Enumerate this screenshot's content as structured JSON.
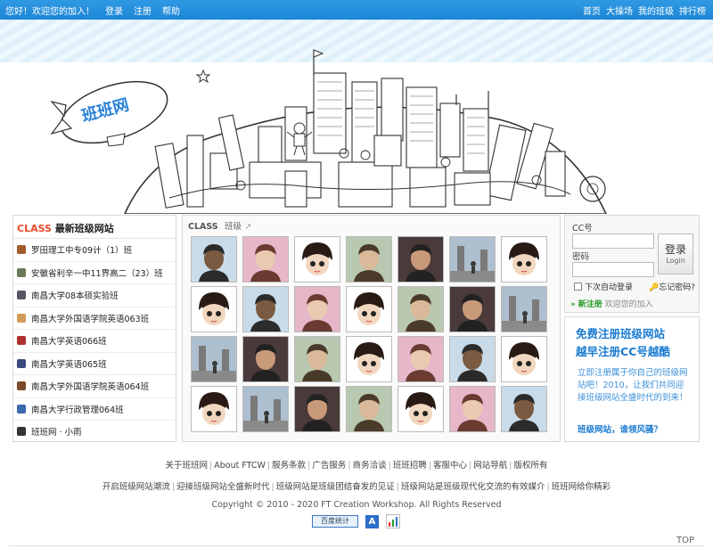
{
  "topbar": {
    "greeting": "您好！欢迎您的加入！",
    "login": "登录",
    "register": "注册",
    "help": "帮助",
    "nav": [
      "首页",
      "大操场",
      "我的班级",
      "排行榜"
    ]
  },
  "banner": {
    "logo_text": "班班网"
  },
  "newclasses": {
    "title_accent": "CLASS",
    "title": "最新班级网站",
    "items": [
      {
        "label": "罗田理工中专09计（1）班"
      },
      {
        "label": "安徽省利辛一中11界高二（23）班"
      },
      {
        "label": "南昌大学08本硕实验班"
      },
      {
        "label": "南昌大学外国语学院英语063班"
      },
      {
        "label": "南昌大学英语066班"
      },
      {
        "label": "南昌大学英语065班"
      },
      {
        "label": "南昌大学外国语学院英语064班"
      },
      {
        "label": "南昌大学行政管理064班"
      },
      {
        "label": "班班网 · 小雨"
      }
    ]
  },
  "classgrid": {
    "title": "CLASS",
    "subtitle": "班级",
    "photos": [
      {
        "icon": "boy-portrait"
      },
      {
        "icon": "girl-portrait"
      },
      {
        "icon": "cartoon-avatar"
      },
      {
        "icon": "boy2-portrait"
      },
      {
        "icon": "man-portrait"
      },
      {
        "icon": "tower-photo"
      },
      {
        "icon": "cartoon-avatar"
      },
      {
        "icon": "cartoon-avatar"
      },
      {
        "icon": "boy-portrait"
      },
      {
        "icon": "girl-portrait"
      },
      {
        "icon": "cartoon-avatar"
      },
      {
        "icon": "boy2-portrait"
      },
      {
        "icon": "man-portrait"
      },
      {
        "icon": "tower-photo"
      },
      {
        "icon": "tower-photo"
      },
      {
        "icon": "man-portrait"
      },
      {
        "icon": "boy2-portrait"
      },
      {
        "icon": "cartoon-avatar"
      },
      {
        "icon": "girl-portrait"
      },
      {
        "icon": "boy-portrait"
      },
      {
        "icon": "cartoon-avatar"
      },
      {
        "icon": "cartoon-avatar"
      },
      {
        "icon": "tower-photo"
      },
      {
        "icon": "man-portrait"
      },
      {
        "icon": "boy2-portrait"
      },
      {
        "icon": "cartoon-avatar"
      },
      {
        "icon": "girl-portrait"
      },
      {
        "icon": "boy-portrait"
      }
    ]
  },
  "login": {
    "cc_label": "CC号",
    "password_label": "密码",
    "button": "登录",
    "button_en": "Login",
    "remember": "下次自动登录",
    "forget": "忘记密码?",
    "newreg": "新注册",
    "welcome": "欢迎您的加入"
  },
  "promo": {
    "line1": "免费注册班级网站",
    "line2": "越早注册CC号越酷",
    "para": "立即注册属于你自己的班级网站吧！2010，让我们共同迎接班级网站全盛时代的到来！",
    "slogan": "班级网站，谁领风骚？"
  },
  "footer": {
    "links1": [
      "关于班班网",
      "About FTCW",
      "服务条款",
      "广告服务",
      "商务洽谈",
      "班班招聘",
      "客服中心",
      "网站导航",
      "版权所有"
    ],
    "links2": [
      "开启班级网站潮流",
      "迎接班级网站全盛新时代",
      "班级网站是班级团结奋发的见证",
      "班级网站是班级现代化交流的有效媒介",
      "班班网给你精彩"
    ],
    "copyright": "Copyright © 2010 - 2020 FT Creation Workshop. All Rights Reserved",
    "baidu": "百度统计",
    "top": "TOP"
  },
  "colors": {
    "topbar": "#1d86d6",
    "accent_red": "#e8492a",
    "promo_blue": "#1a7bd1",
    "green": "#2a9a2a"
  }
}
